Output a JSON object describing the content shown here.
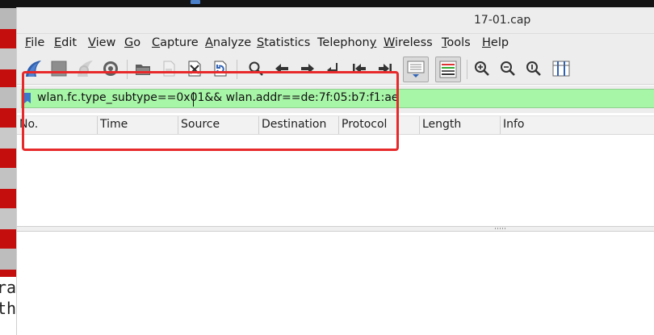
{
  "window": {
    "title": "17-01.cap"
  },
  "menubar": {
    "items": [
      {
        "label": "File",
        "key": "F"
      },
      {
        "label": "Edit",
        "key": "E"
      },
      {
        "label": "View",
        "key": "V"
      },
      {
        "label": "Go",
        "key": "G"
      },
      {
        "label": "Capture",
        "key": "C"
      },
      {
        "label": "Analyze",
        "key": "A"
      },
      {
        "label": "Statistics",
        "key": "S"
      },
      {
        "label": "Telephony",
        "key": "y"
      },
      {
        "label": "Wireless",
        "key": "W"
      },
      {
        "label": "Tools",
        "key": "T"
      },
      {
        "label": "Help",
        "key": "H"
      }
    ]
  },
  "toolbar": {
    "icons": [
      "shark-fin-start-icon",
      "stop-square-icon",
      "restart-fin-icon",
      "capture-options-gear-icon",
      "open-folder-icon",
      "save-file-icon",
      "close-file-icon",
      "reload-file-icon",
      "find-packet-icon",
      "go-back-icon",
      "go-forward-icon",
      "go-to-packet-icon",
      "first-packet-icon",
      "last-packet-icon",
      "autoscroll-icon",
      "colorize-icon",
      "zoom-in-icon",
      "zoom-out-icon",
      "normal-size-icon",
      "resize-columns-icon"
    ]
  },
  "filter": {
    "value": "wlan.fc.type_subtype==0x01&& wlan.addr==de:7f:05:b7:f1:ae",
    "background": "#a7f5a7"
  },
  "packet_list": {
    "columns": [
      "No.",
      "Time",
      "Source",
      "Destination",
      "Protocol",
      "Length",
      "Info"
    ],
    "rows": []
  },
  "background": {
    "terminal_lines": [
      "ra",
      "th"
    ]
  },
  "annotation": {
    "color": "#e8292b"
  }
}
